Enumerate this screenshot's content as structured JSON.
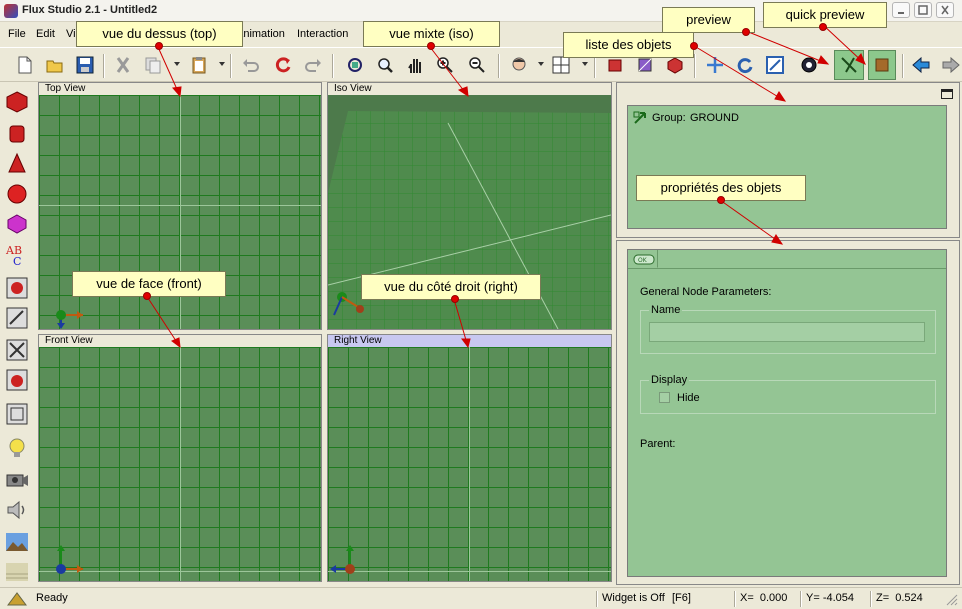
{
  "window": {
    "title": "Flux Studio 2.1 - Untitled2",
    "controls": [
      "minimize",
      "maximize",
      "close"
    ]
  },
  "menu": {
    "file": "File",
    "edit": "Edit",
    "view": "Vi",
    "animation": "Animation",
    "interaction": "Interaction"
  },
  "viewports": {
    "top": "Top View",
    "iso": "Iso View",
    "front": "Front View",
    "right": "Right View"
  },
  "object_list": {
    "group_label": "Group:",
    "group_name": "GROUND"
  },
  "properties": {
    "tab_icon": "node-icon",
    "section_title": "General Node Parameters:",
    "name_label": "Name",
    "name_value": "",
    "display_label": "Display",
    "hide_label": "Hide",
    "hide_checked": false,
    "parent_label": "Parent:"
  },
  "annotations": {
    "top": "vue du dessus (top)",
    "iso": "vue mixte (iso)",
    "front": "vue de face (front)",
    "right": "vue du côté droit (right)",
    "list": "liste des objets",
    "props": "propriétés des objets",
    "preview": "preview",
    "quick": "quick preview"
  },
  "status": {
    "ready": "Ready",
    "widget": "Widget is Off",
    "widget_key": "[F6]",
    "x": "X=  0.000",
    "y": "Y= -4.054",
    "z": "Z=  0.524"
  },
  "colors": {
    "viewport_green": "#5a8e58",
    "panel_green": "#94c594",
    "callout": "#ffffc2",
    "arrow_red": "#e00000"
  }
}
